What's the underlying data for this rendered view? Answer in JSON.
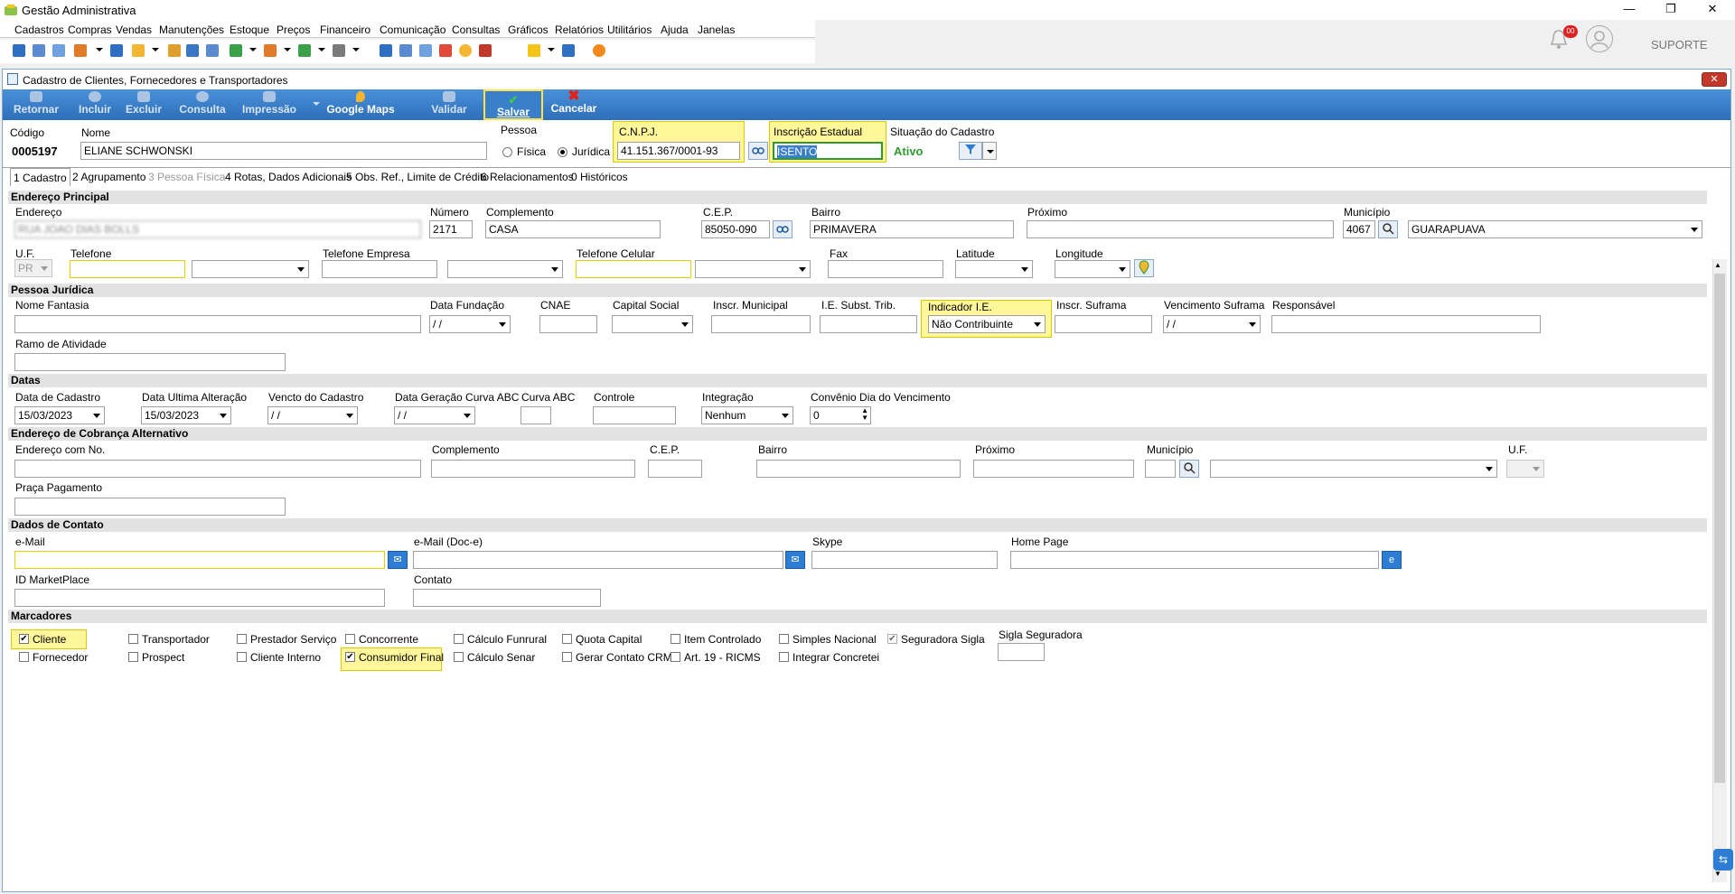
{
  "app": {
    "title": "Gestão Administrativa",
    "min": "—",
    "restore": "❐",
    "close": "✕"
  },
  "menu": [
    "Cadastros",
    "Compras",
    "Vendas",
    "Manutenções",
    "Estoque",
    "Preços",
    "Financeiro",
    "Comunicação",
    "Consultas",
    "Gráficos",
    "Relatórios",
    "Utilitários",
    "Ajuda",
    "Janelas"
  ],
  "top_right": {
    "notif_count": "00",
    "user": "SUPORTE"
  },
  "window": {
    "title": "Cadastro de Clientes, Fornecedores e Transportadores",
    "close": "✕"
  },
  "ribbon": {
    "retornar": "Retornar",
    "incluir": "Incluir",
    "excluir": "Excluir",
    "consulta": "Consulta",
    "impressao": "Impressão",
    "google_maps": "Google Maps",
    "validar": "Validar",
    "salvar": "Salvar",
    "cancelar": "Cancelar"
  },
  "header": {
    "codigo_label": "Código",
    "codigo": "0005197",
    "nome_label": "Nome",
    "nome": "ELIANE SCHWONSKI",
    "pessoa_label": "Pessoa",
    "fisica": "Física",
    "juridica": "Jurídica",
    "cnpj_label": "C.N.P.J.",
    "cnpj": "41.151.367/0001-93",
    "ie_label": "Inscrição Estadual",
    "ie": "ISENTO",
    "situacao_label": "Situação do Cadastro",
    "situacao": "Ativo"
  },
  "tabs": [
    "1 Cadastro",
    "2 Agrupamento",
    "3 Pessoa Física",
    "4 Rotas, Dados Adicionais",
    "5 Obs. Ref., Limite de Crédito",
    "6 Relacionamentos",
    "0 Históricos"
  ],
  "endereco": {
    "section": "Endereço Principal",
    "endereco_label": "Endereço",
    "endereco": "RUA JOAO DIAS BOLLS",
    "numero_label": "Número",
    "numero": "2171",
    "complemento_label": "Complemento",
    "complemento": "CASA",
    "cep_label": "C.E.P.",
    "cep": "85050-090",
    "bairro_label": "Bairro",
    "bairro": "PRIMAVERA",
    "proximo_label": "Próximo",
    "proximo": "",
    "municipio_label": "Município",
    "municipio_cod": "4067",
    "municipio": "GUARAPUAVA",
    "uf_label": "U.F.",
    "uf": "PR",
    "telefone_label": "Telefone",
    "telefone_empresa_label": "Telefone Empresa",
    "telefone_celular_label": "Telefone Celular",
    "fax_label": "Fax",
    "latitude_label": "Latitude",
    "longitude_label": "Longitude"
  },
  "pj": {
    "section": "Pessoa Jurídica",
    "nome_fantasia": "Nome Fantasia",
    "data_fundacao": "Data Fundação",
    "data_fundacao_val": " / /",
    "cnae": "CNAE",
    "capital_social": "Capital Social",
    "inscr_municipal": "Inscr. Municipal",
    "ie_subst": "I.E. Subst. Trib.",
    "indicador_ie": "Indicador I.E.",
    "indicador_ie_val": "Não Contribuinte",
    "inscr_suframa": "Inscr. Suframa",
    "venc_suframa": "Vencimento Suframa",
    "venc_suframa_val": " / /",
    "responsavel": "Responsável",
    "ramo": "Ramo de Atividade"
  },
  "datas": {
    "section": "Datas",
    "data_cadastro": "Data de Cadastro",
    "data_cadastro_val": "15/03/2023",
    "data_ultima": "Data Ultima Alteração",
    "data_ultima_val": "15/03/2023",
    "vencto": "Vencto do Cadastro",
    "vencto_val": " / /",
    "data_curva": "Data Geração Curva ABC",
    "data_curva_val": " / /",
    "curva": "Curva ABC",
    "controle": "Controle",
    "integracao": "Integração",
    "integracao_val": "Nenhum",
    "convenio": "Convênio Dia do Vencimento",
    "convenio_val": "0"
  },
  "cobranca": {
    "section": "Endereço de Cobrança Alternativo",
    "endereco": "Endereço com No.",
    "complemento": "Complemento",
    "cep": "C.E.P.",
    "bairro": "Bairro",
    "proximo": "Próximo",
    "municipio": "Município",
    "uf": "U.F.",
    "praca": "Praça Pagamento"
  },
  "contato": {
    "section": "Dados de Contato",
    "email": "e-Mail",
    "email_doc": "e-Mail (Doc-e)",
    "skype": "Skype",
    "homepage": "Home Page",
    "id_marketplace": "ID MarketPlace",
    "contato": "Contato"
  },
  "marcadores": {
    "section": "Marcadores",
    "items": [
      {
        "label": "Cliente",
        "checked": true
      },
      {
        "label": "Transportador",
        "checked": false
      },
      {
        "label": "Prestador Serviço",
        "checked": false
      },
      {
        "label": "Concorrente",
        "checked": false
      },
      {
        "label": "Cálculo Funrural",
        "checked": false
      },
      {
        "label": "Quota Capital",
        "checked": false
      },
      {
        "label": "Item Controlado",
        "checked": false
      },
      {
        "label": "Simples Nacional",
        "checked": false
      },
      {
        "label": "Seguradora Sigla",
        "checked": true
      },
      {
        "label": "Fornecedor",
        "checked": false
      },
      {
        "label": "Prospect",
        "checked": false
      },
      {
        "label": "Cliente Interno",
        "checked": false
      },
      {
        "label": "Consumidor Final",
        "checked": true
      },
      {
        "label": "Cálculo Senar",
        "checked": false
      },
      {
        "label": "Gerar Contato CRM",
        "checked": false
      },
      {
        "label": "Art. 19 - RICMS",
        "checked": false
      },
      {
        "label": "Integrar Concreteira",
        "checked": false
      }
    ],
    "sigla_label": "Sigla Seguradora"
  },
  "colors": {
    "ribbon": "#2d6fb8",
    "highlight": "#fff799",
    "ativo": "#2e9b2e"
  }
}
